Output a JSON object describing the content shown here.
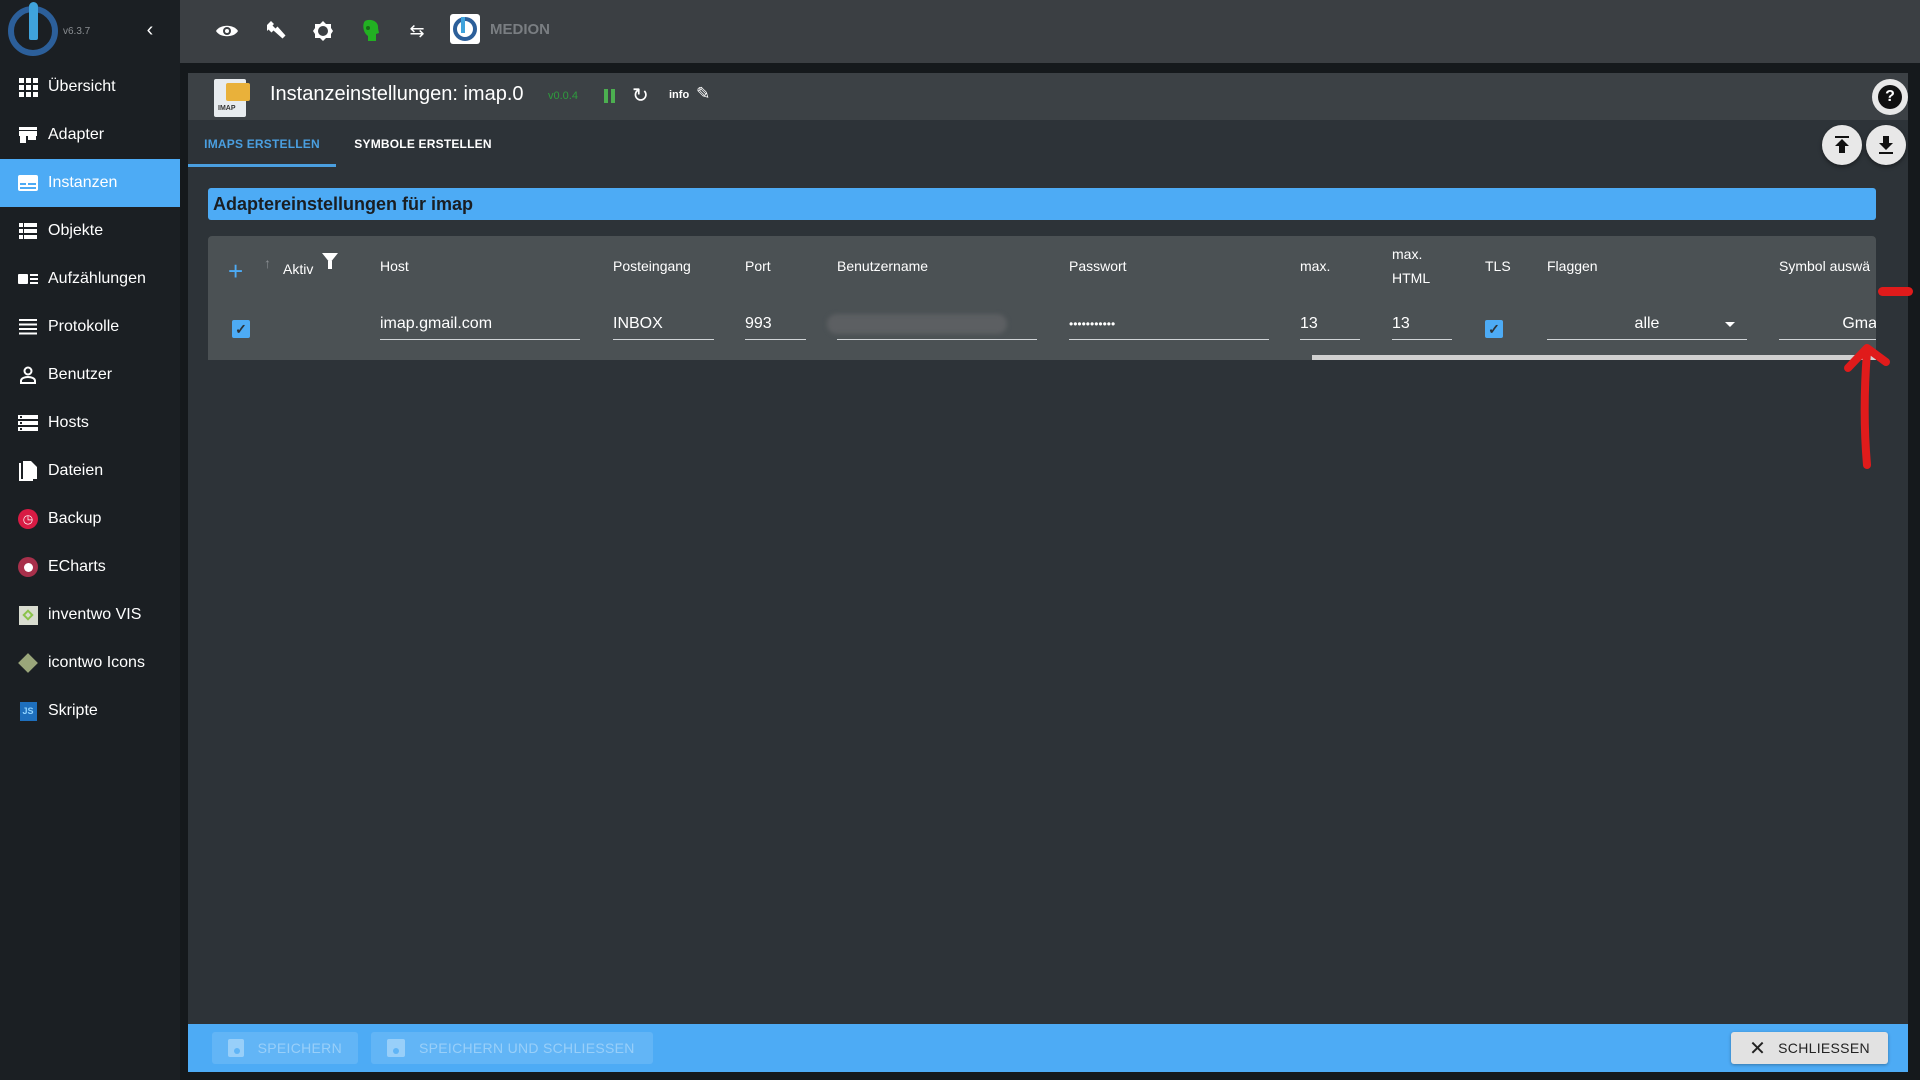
{
  "sidebar": {
    "version": "v6.3.7",
    "collapse_icon": "chevron-left",
    "items": [
      {
        "label": "Übersicht",
        "icon": "grid-icon",
        "active": false
      },
      {
        "label": "Adapter",
        "icon": "store-icon",
        "active": false
      },
      {
        "label": "Instanzen",
        "icon": "instances-icon",
        "active": true
      },
      {
        "label": "Objekte",
        "icon": "list-icon",
        "active": false
      },
      {
        "label": "Aufzählungen",
        "icon": "enum-icon",
        "active": false
      },
      {
        "label": "Protokolle",
        "icon": "log-icon",
        "active": false
      },
      {
        "label": "Benutzer",
        "icon": "user-icon",
        "active": false
      },
      {
        "label": "Hosts",
        "icon": "hosts-icon",
        "active": false
      },
      {
        "label": "Dateien",
        "icon": "files-icon",
        "active": false
      },
      {
        "label": "Backup",
        "icon": "backup-icon",
        "active": false
      },
      {
        "label": "ECharts",
        "icon": "echarts-icon",
        "active": false
      },
      {
        "label": "inventwo VIS",
        "icon": "inventwo-icon",
        "active": false
      },
      {
        "label": "icontwo Icons",
        "icon": "icontwo-icon",
        "active": false
      },
      {
        "label": "Skripte",
        "icon": "js-icon",
        "active": false
      }
    ]
  },
  "topbar": {
    "icons": [
      "eye-icon",
      "wrench-icon",
      "gear-icon",
      "expert-head-icon",
      "sync-off-icon"
    ],
    "host_name": "MEDION"
  },
  "dialog": {
    "title": "Instanzeinstellungen: imap.0",
    "adapter_icon_label": "IMAP",
    "version": "v0.0.4",
    "info_label": "info",
    "help_label": "?",
    "tabs": [
      {
        "label": "IMAPS ERSTELLEN",
        "active": true
      },
      {
        "label": "SYMBOLE ERSTELLEN",
        "active": false
      }
    ],
    "section_title": "Adaptereinstellungen für imap",
    "table": {
      "columns": [
        "Aktiv",
        "Host",
        "Posteingang",
        "Port",
        "Benutzername",
        "Passwort",
        "max.",
        "max. HTML",
        "TLS",
        "Flaggen",
        "Symbol auswä"
      ],
      "column_max_html": [
        "max.",
        "HTML"
      ],
      "rows": [
        {
          "aktiv": true,
          "host": "imap.gmail.com",
          "posteingang": "INBOX",
          "port": "993",
          "benutzername": "",
          "passwort": "•••••••••••",
          "max": "13",
          "max_html": "13",
          "tls": true,
          "flaggen": "alle",
          "symbol": "Gma"
        }
      ]
    },
    "footer": {
      "save_label": "SPEICHERN",
      "save_close_label": "SPEICHERN UND SCHLIESSEN",
      "close_label": "SCHLIESSEN"
    }
  },
  "colors": {
    "accent": "#4dabf5",
    "sidebar_bg": "#1b1f23",
    "dialog_bg": "#2d3338",
    "version_green": "#2e9c3d",
    "annotation_red": "#e01b1b"
  }
}
